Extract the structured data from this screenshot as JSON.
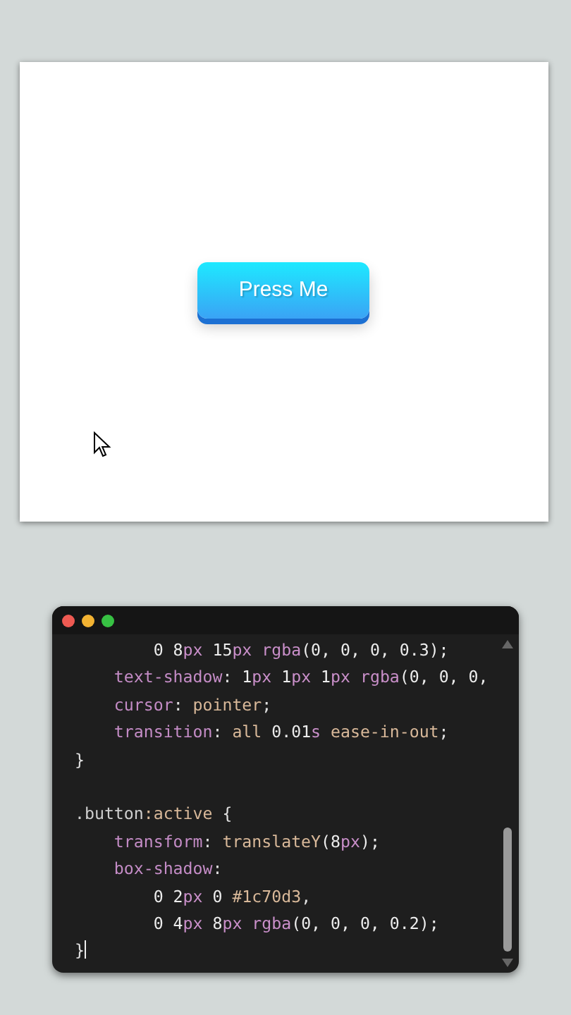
{
  "preview": {
    "button": {
      "label": "Press Me"
    }
  },
  "editor": {
    "lines": [
      {
        "tokens": [
          {
            "kind": "num",
            "text": "        0 8"
          },
          {
            "kind": "unit",
            "text": "px"
          },
          {
            "kind": "num",
            "text": " 15"
          },
          {
            "kind": "unit",
            "text": "px"
          },
          {
            "kind": "fn",
            "text": " rgba"
          },
          {
            "kind": "num",
            "text": "(0, 0, 0, 0.3);"
          }
        ]
      },
      {
        "tokens": [
          {
            "kind": "prop",
            "text": "    text-shadow"
          },
          {
            "kind": "punct",
            "text": ": "
          },
          {
            "kind": "num",
            "text": "1"
          },
          {
            "kind": "unit",
            "text": "px"
          },
          {
            "kind": "num",
            "text": " 1"
          },
          {
            "kind": "unit",
            "text": "px"
          },
          {
            "kind": "num",
            "text": " 1"
          },
          {
            "kind": "unit",
            "text": "px"
          },
          {
            "kind": "fn",
            "text": " rgba"
          },
          {
            "kind": "num",
            "text": "(0, 0, 0,"
          }
        ]
      },
      {
        "tokens": [
          {
            "kind": "prop",
            "text": "    cursor"
          },
          {
            "kind": "punct",
            "text": ": "
          },
          {
            "kind": "value",
            "text": "pointer"
          },
          {
            "kind": "punct",
            "text": ";"
          }
        ]
      },
      {
        "tokens": [
          {
            "kind": "prop",
            "text": "    transition"
          },
          {
            "kind": "punct",
            "text": ": "
          },
          {
            "kind": "value",
            "text": "all "
          },
          {
            "kind": "num",
            "text": "0.01"
          },
          {
            "kind": "unit",
            "text": "s"
          },
          {
            "kind": "value",
            "text": " ease-in-out"
          },
          {
            "kind": "punct",
            "text": ";"
          }
        ]
      },
      {
        "tokens": [
          {
            "kind": "punct",
            "text": "}"
          }
        ]
      },
      {
        "kind": "blank"
      },
      {
        "tokens": [
          {
            "kind": "selector",
            "text": ".button"
          },
          {
            "kind": "value",
            "text": ":active"
          },
          {
            "kind": "punct",
            "text": " {"
          }
        ]
      },
      {
        "tokens": [
          {
            "kind": "prop",
            "text": "    transform"
          },
          {
            "kind": "punct",
            "text": ": "
          },
          {
            "kind": "value",
            "text": "translateY"
          },
          {
            "kind": "num",
            "text": "(8"
          },
          {
            "kind": "unit",
            "text": "px"
          },
          {
            "kind": "num",
            "text": ");"
          }
        ]
      },
      {
        "tokens": [
          {
            "kind": "prop",
            "text": "    box-shadow"
          },
          {
            "kind": "punct",
            "text": ":"
          }
        ]
      },
      {
        "tokens": [
          {
            "kind": "num",
            "text": "        0 2"
          },
          {
            "kind": "unit",
            "text": "px"
          },
          {
            "kind": "num",
            "text": " 0 "
          },
          {
            "kind": "value",
            "text": "#1c70d3"
          },
          {
            "kind": "punct",
            "text": ","
          }
        ]
      },
      {
        "tokens": [
          {
            "kind": "num",
            "text": "        0 4"
          },
          {
            "kind": "unit",
            "text": "px"
          },
          {
            "kind": "num",
            "text": " 8"
          },
          {
            "kind": "unit",
            "text": "px"
          },
          {
            "kind": "fn",
            "text": " rgba"
          },
          {
            "kind": "num",
            "text": "(0, 0, 0, 0.2);"
          }
        ]
      },
      {
        "tokens": [
          {
            "kind": "punct",
            "text": "}"
          }
        ],
        "caret": true
      }
    ]
  }
}
